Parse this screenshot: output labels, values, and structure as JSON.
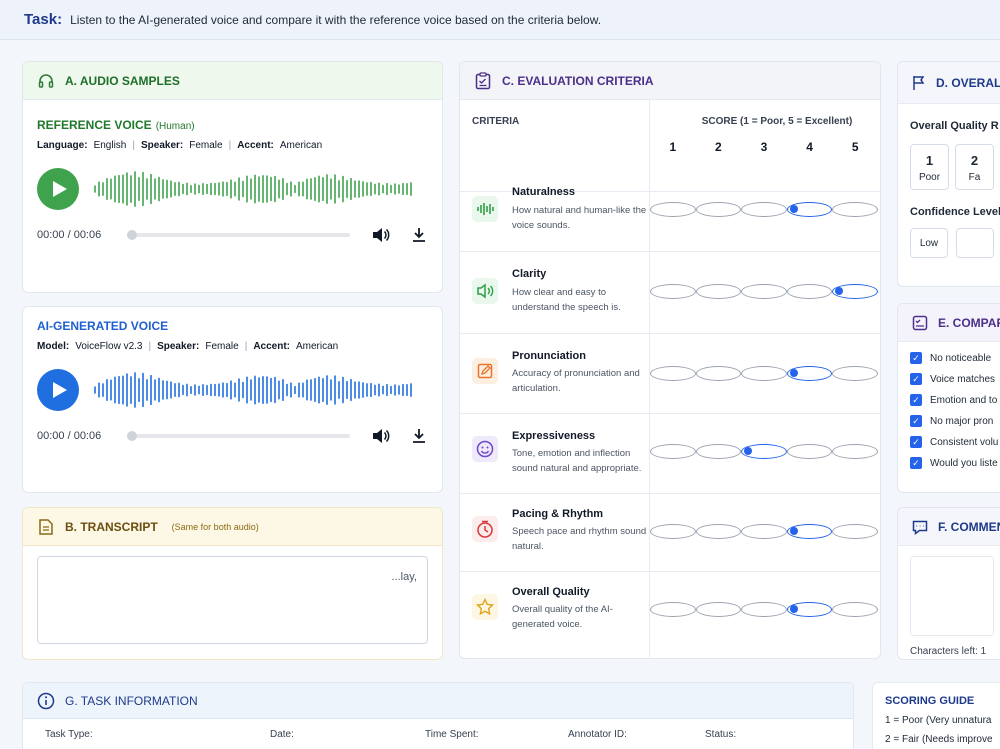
{
  "task": {
    "label": "Task:",
    "text": "Listen to the AI-generated voice and compare it with the reference voice based on the criteria below."
  },
  "audio": {
    "title": "A. AUDIO SAMPLES",
    "reference": {
      "title": "REFERENCE VOICE",
      "subtitle": "(Human)",
      "language_label": "Language:",
      "language": "English",
      "speaker_label": "Speaker:",
      "speaker": "Female",
      "accent_label": "Accent:",
      "accent": "American",
      "time": "00:00 / 00:06",
      "progress": 0
    },
    "generated": {
      "title": "AI-GENERATED VOICE",
      "model_label": "Model:",
      "model": "VoiceFlow v2.3",
      "speaker_label": "Speaker:",
      "speaker": "Female",
      "accent_label": "Accent:",
      "accent": "American",
      "time": "00:00 / 00:06",
      "progress": 0
    },
    "colors": {
      "reference": "#3fa34d",
      "generated": "#1f6fe0"
    }
  },
  "transcript": {
    "title": "B. TRANSCRIPT",
    "subtitle": "(Same for both audio)",
    "text": "...lay,"
  },
  "criteria": {
    "title": "C. EVALUATION CRITERIA",
    "criteria_header": "CRITERIA",
    "score_header": "SCORE (1 = Poor, 5 = Excellent)",
    "scale": [
      "1",
      "2",
      "3",
      "4",
      "5"
    ],
    "rows": [
      {
        "name": "Naturalness",
        "desc": "How natural and human-like the voice sounds.",
        "icon": "waveform-icon",
        "selected": 4
      },
      {
        "name": "Clarity",
        "desc": "How clear and easy to understand the speech is.",
        "icon": "speaker-icon",
        "selected": 5
      },
      {
        "name": "Pronunciation",
        "desc": "Accuracy of pronunciation and articulation.",
        "icon": "edit-icon",
        "selected": 4
      },
      {
        "name": "Expressiveness",
        "desc": "Tone, emotion and inflection sound natural and appropriate.",
        "icon": "smile-icon",
        "selected": 3
      },
      {
        "name": "Pacing & Rhythm",
        "desc": "Speech pace and rhythm sound natural.",
        "icon": "clock-icon",
        "selected": 4
      },
      {
        "name": "Overall Quality",
        "desc": "Overall quality of the AI-generated voice.",
        "icon": "star-icon",
        "selected": 4
      }
    ]
  },
  "overall": {
    "title": "D. OVERALL",
    "rating_label": "Overall Quality R",
    "options": [
      {
        "num": "1",
        "label": "Poor"
      },
      {
        "num": "2",
        "label": "Fa"
      }
    ],
    "confidence_label": "Confidence Level",
    "confidence_options": [
      "Low",
      ""
    ]
  },
  "comparison": {
    "title": "E. COMPARI",
    "items": [
      "No noticeable",
      "Voice matches",
      "Emotion and to",
      "No major pron",
      "Consistent volu",
      "Would you liste"
    ]
  },
  "comments": {
    "title": "F. COMMEN",
    "chars_left": "Characters left: 1"
  },
  "task_info": {
    "title": "G. TASK INFORMATION",
    "fields": [
      "Task Type:",
      "Date:",
      "Time Spent:",
      "Annotator ID:",
      "Status:"
    ]
  },
  "scoring_guide": {
    "title": "SCORING GUIDE",
    "lines": [
      "1 = Poor (Very unnatura",
      "2 = Fair (Needs improve"
    ]
  }
}
